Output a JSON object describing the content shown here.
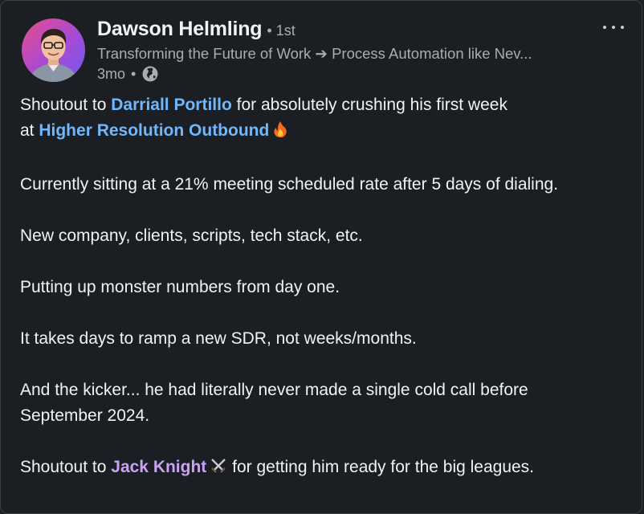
{
  "post": {
    "author": {
      "name": "Dawson Helmling",
      "degree": "• 1st",
      "headline": "Transforming the Future of Work ➔ Process Automation like Nev...",
      "age": "3mo",
      "separator": "•",
      "visibility_icon": "globe-icon"
    },
    "menu_icon": "more-options-icon",
    "body": {
      "line1_prefix": "Shoutout to ",
      "mention1": "Darriall Portillo",
      "line1_suffix": " for absolutely crushing his first week",
      "line2_prefix": "at ",
      "mention2": "Higher Resolution Outbound",
      "emoji1": "fire-icon",
      "para2": "Currently sitting at a 21% meeting scheduled rate after 5 days of dialing.",
      "para3": "New company, clients, scripts, tech stack, etc.",
      "para4": "Putting up monster numbers from day one.",
      "para5": "It takes days to ramp a new SDR, not weeks/months.",
      "para6_line1": "And the kicker... he had literally never made a single cold call before",
      "para6_line2": "September 2024.",
      "last_prefix": "Shoutout to ",
      "mention3": "Jack Knight",
      "emoji2": "crossed-swords-icon",
      "last_suffix": " for getting him ready for the big leagues."
    },
    "colors": {
      "background": "#1b1f23",
      "text": "#f2f2f2",
      "muted": "#a9adb2",
      "company_mention": "#71b7fb",
      "person_mention": "#c9a2f5"
    }
  }
}
